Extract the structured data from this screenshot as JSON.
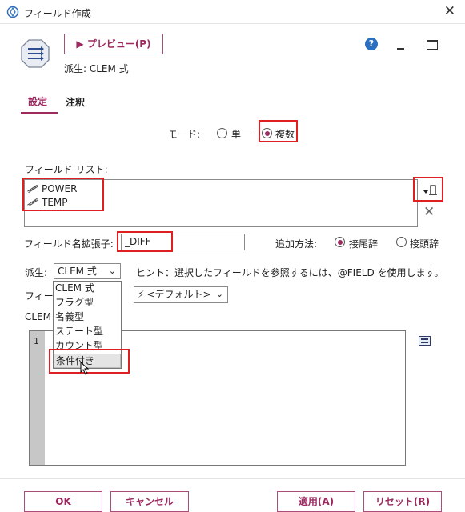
{
  "window": {
    "title": "フィールド作成",
    "close_glyph": "✕"
  },
  "toolbar": {
    "preview_label": "▶ プレビュー(P)",
    "derive_info": "派生: CLEM 式"
  },
  "tabs": [
    {
      "label": "設定"
    },
    {
      "label": "注釈"
    }
  ],
  "mode": {
    "label": "モード:",
    "options": [
      "単一",
      "複数"
    ],
    "selected": "複数"
  },
  "field_list": {
    "label": "フィールド リスト:",
    "items": [
      "POWER",
      "TEMP"
    ]
  },
  "extension": {
    "label": "フィールド名拡張子:",
    "value": "_DIFF"
  },
  "add_method": {
    "label": "追加方法:",
    "options": [
      "接尾辞",
      "接頭辞"
    ],
    "selected": "接尾辞"
  },
  "derive": {
    "label": "派生:",
    "selected": "CLEM 式",
    "hint": "ヒント：選択したフィールドを参照するには、@FIELD を使用します。",
    "options": [
      "CLEM 式",
      "フラグ型",
      "名義型",
      "ステート型",
      "カウント型",
      "条件付き"
    ],
    "highlighted": "条件付き"
  },
  "field_type": {
    "label_visible": "フィー",
    "value": "<デフォルト>"
  },
  "clem": {
    "label_visible": "CLEM",
    "line_number": "1"
  },
  "buttons": {
    "ok": "OK",
    "cancel": "キャンセル",
    "apply": "適用(A)",
    "reset": "リセット(R)"
  },
  "colors": {
    "accent": "#9c2a5f",
    "highlight_box": "#e02020",
    "help": "#2b6fc1"
  }
}
